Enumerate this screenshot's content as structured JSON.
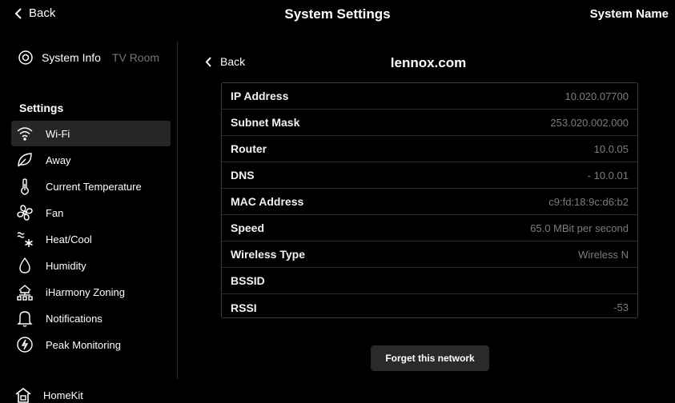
{
  "header": {
    "back_label": "Back",
    "title": "System Settings",
    "system_name": "System Name"
  },
  "sidebar": {
    "system_info": {
      "label": "System Info",
      "room": "TV Room",
      "icon": "target-icon"
    },
    "settings_heading": "Settings",
    "items": [
      {
        "label": "Wi-Fi",
        "icon": "wifi-icon",
        "active": true
      },
      {
        "label": "Away",
        "icon": "leaf-icon"
      },
      {
        "label": "Current Temperature",
        "icon": "thermometer-icon"
      },
      {
        "label": "Fan",
        "icon": "fan-icon"
      },
      {
        "label": "Heat/Cool",
        "icon": "heat-cool-icon"
      },
      {
        "label": "Humidity",
        "icon": "droplet-icon"
      },
      {
        "label": "iHarmony Zoning",
        "icon": "zoning-icon"
      },
      {
        "label": "Notifications",
        "icon": "bell-icon"
      },
      {
        "label": "Peak Monitoring",
        "icon": "lightning-icon"
      }
    ],
    "homekit": {
      "label": "HomeKit",
      "icon": "home-icon"
    }
  },
  "content": {
    "back_label": "Back",
    "network_name": "lennox.com",
    "rows": [
      {
        "key": "IP Address",
        "value": "10.020.07700"
      },
      {
        "key": "Subnet Mask",
        "value": "253.020.002.000"
      },
      {
        "key": "Router",
        "value": "10.0.05"
      },
      {
        "key": "DNS",
        "value": "- 10.0.01"
      },
      {
        "key": "MAC Address",
        "value": "c9:fd:18:9c:d6:b2"
      },
      {
        "key": "Speed",
        "value": "65.0 MBit per second"
      },
      {
        "key": "Wireless Type",
        "value": "Wireless N"
      },
      {
        "key": "BSSID",
        "value": ""
      },
      {
        "key": "RSSI",
        "value": "-53"
      }
    ],
    "forget_label": "Forget this network"
  },
  "colors": {
    "background": "#000000",
    "active_item": "#262626",
    "muted_text": "#7d7d7d",
    "button": "#2a2a2a"
  }
}
